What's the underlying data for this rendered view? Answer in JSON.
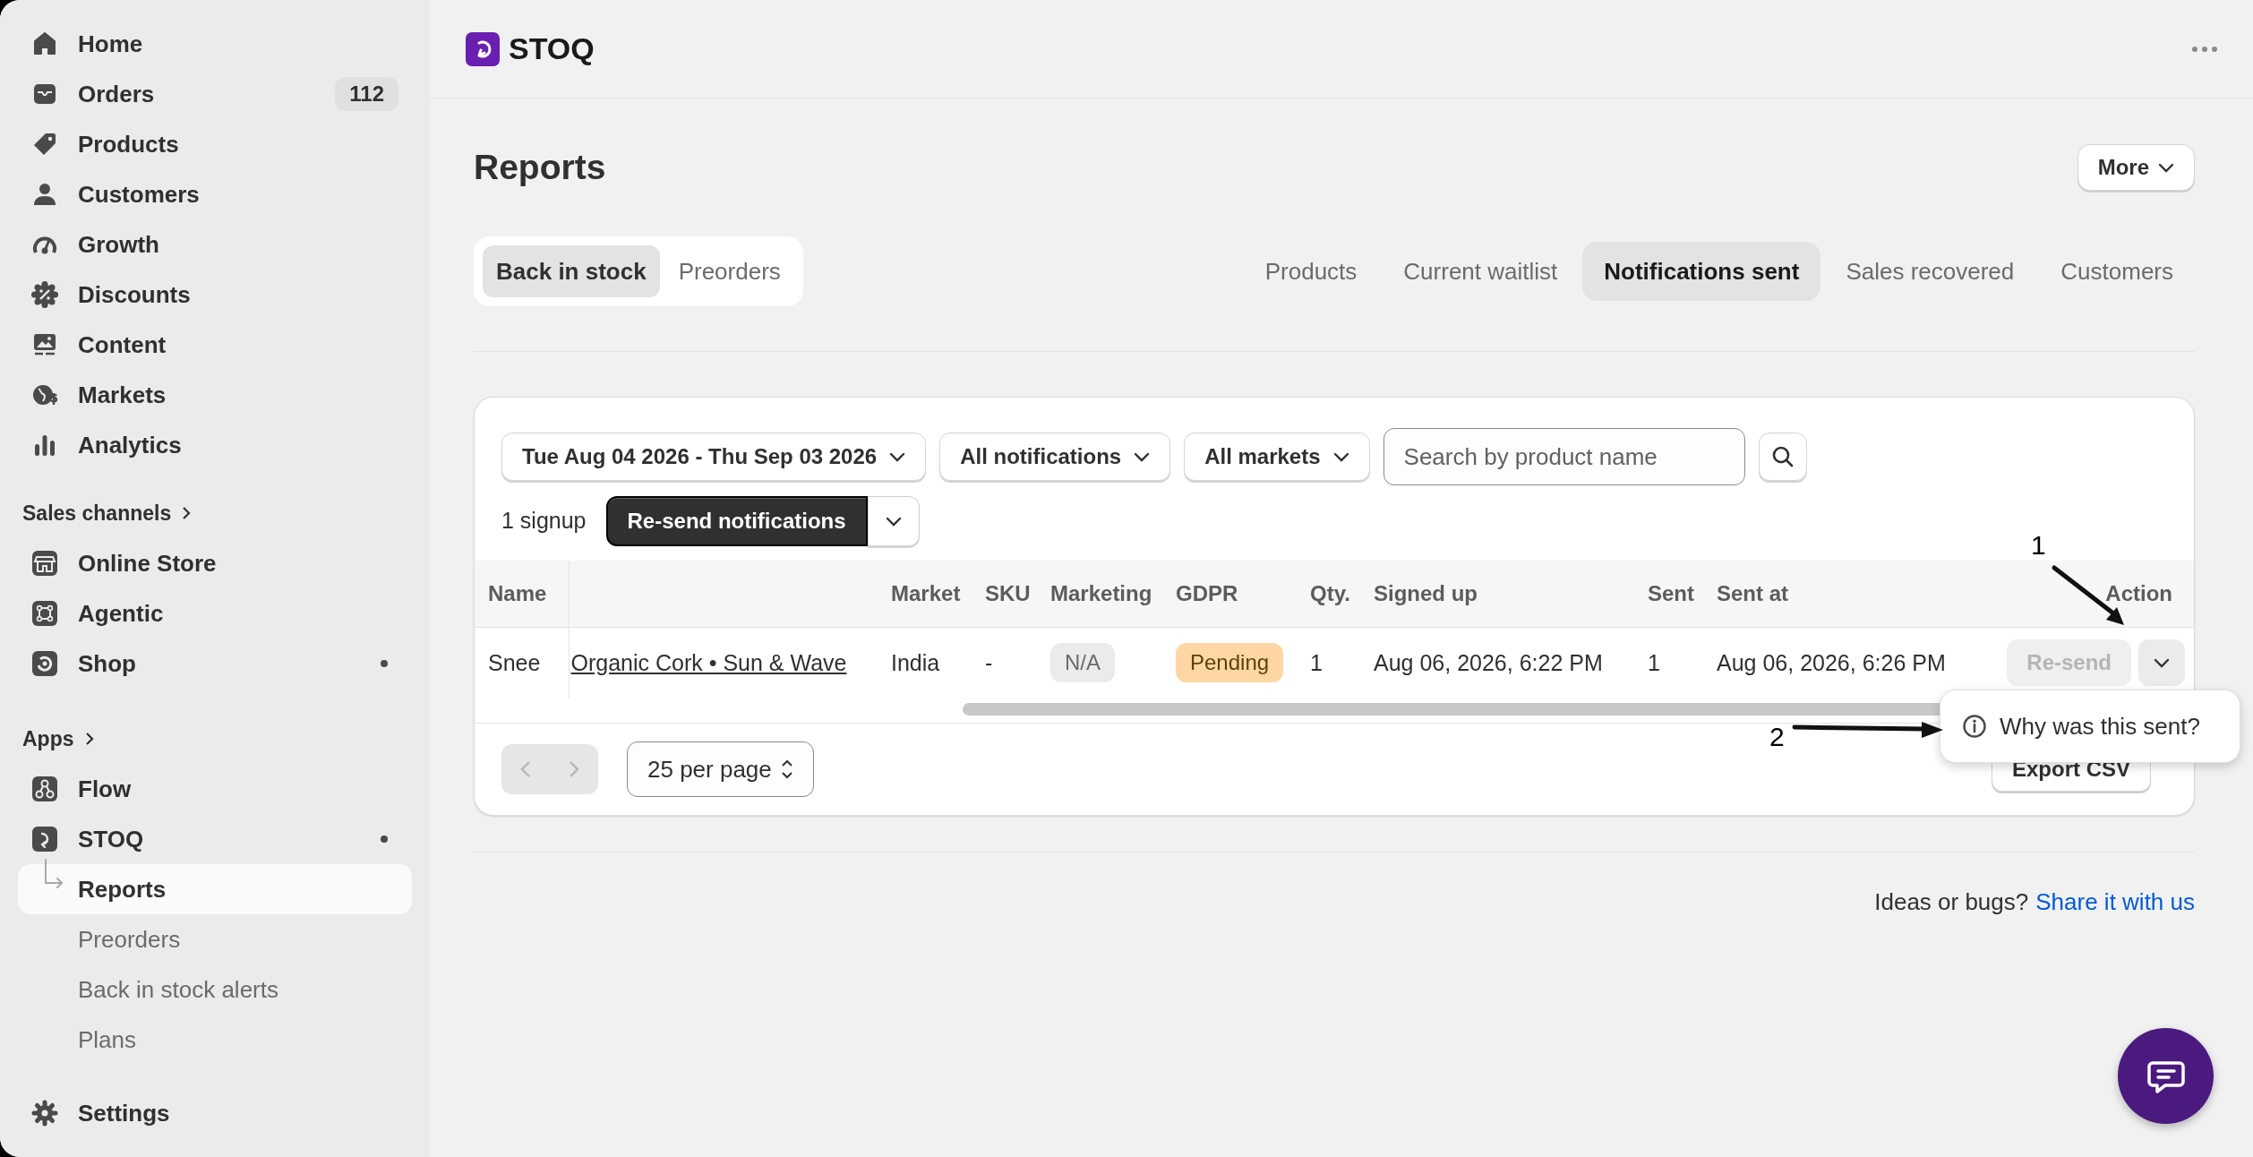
{
  "sidebar": {
    "main_items": [
      {
        "label": "Home"
      },
      {
        "label": "Orders",
        "badge": "112"
      },
      {
        "label": "Products"
      },
      {
        "label": "Customers"
      },
      {
        "label": "Growth"
      },
      {
        "label": "Discounts"
      },
      {
        "label": "Content"
      },
      {
        "label": "Markets"
      },
      {
        "label": "Analytics"
      }
    ],
    "sales_channels": {
      "label": "Sales channels",
      "items": [
        {
          "label": "Online Store",
          "unread": false
        },
        {
          "label": "Agentic",
          "unread": false
        },
        {
          "label": "Shop",
          "unread": true
        }
      ]
    },
    "apps": {
      "label": "Apps",
      "items": [
        {
          "label": "Flow",
          "unread": false
        },
        {
          "label": "STOQ",
          "unread": true,
          "children": [
            {
              "label": "Reports",
              "selected": true
            },
            {
              "label": "Preorders",
              "selected": false
            },
            {
              "label": "Back in stock alerts",
              "selected": false
            },
            {
              "label": "Plans",
              "selected": false
            }
          ]
        }
      ]
    },
    "settings": {
      "label": "Settings"
    }
  },
  "header": {
    "app_name": "STOQ"
  },
  "page": {
    "title": "Reports",
    "more_button": "More"
  },
  "segment_tabs": [
    {
      "label": "Back in stock",
      "selected": true
    },
    {
      "label": "Preorders",
      "selected": false
    }
  ],
  "report_tabs": [
    {
      "label": "Products",
      "selected": false
    },
    {
      "label": "Current waitlist",
      "selected": false
    },
    {
      "label": "Notifications sent",
      "selected": true
    },
    {
      "label": "Sales recovered",
      "selected": false
    },
    {
      "label": "Customers",
      "selected": false
    }
  ],
  "filters": {
    "date_range": "Tue Aug 04 2026 - Thu Sep 03 2026",
    "notifications": "All notifications",
    "markets": "All markets",
    "search": {
      "placeholder": "Search by product name"
    }
  },
  "selection": {
    "count": "1 signup",
    "bulk_button": "Re-send notifications"
  },
  "table": {
    "columns": [
      "Name",
      "Market",
      "SKU",
      "Marketing",
      "GDPR",
      "Qty.",
      "Signed up",
      "Sent",
      "Sent at",
      "Action"
    ],
    "rows": [
      {
        "name": "Snee",
        "product": "Organic Cork • Sun & Wave",
        "market": "India",
        "sku": "-",
        "marketing": {
          "text": "N/A",
          "kind": "neutral"
        },
        "gdpr": {
          "text": "Pending",
          "kind": "warning"
        },
        "qty": "1",
        "signed_up": "Aug 06, 2026, 6:22 PM",
        "sent": "1",
        "sent_at": "Aug 06, 2026, 6:26 PM",
        "action": {
          "label": "Re-send",
          "disabled": true
        }
      }
    ]
  },
  "pagination": {
    "previous_disabled": true,
    "next_disabled": true,
    "per_page": "25 per page",
    "export_button": "Export CSV"
  },
  "popup_menu": {
    "items": [
      {
        "label": "Why was this sent?"
      }
    ]
  },
  "annotations": [
    {
      "label": "1"
    },
    {
      "label": "2"
    }
  ],
  "footer": {
    "text": "Ideas or bugs?",
    "link": "Share it with us"
  }
}
